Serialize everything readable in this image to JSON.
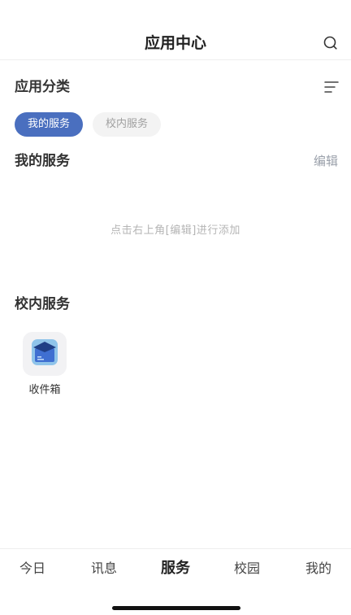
{
  "header": {
    "title": "应用中心"
  },
  "categories": {
    "label": "应用分类"
  },
  "chips": [
    {
      "label": "我的服务"
    },
    {
      "label": "校内服务"
    }
  ],
  "my_services": {
    "title": "我的服务",
    "edit_label": "编辑",
    "empty_hint": "点击右上角[编辑]进行添加"
  },
  "campus_services": {
    "title": "校内服务",
    "apps": [
      {
        "label": "收件箱",
        "icon": "inbox-icon"
      }
    ]
  },
  "tabbar": {
    "tabs": [
      {
        "label": "今日"
      },
      {
        "label": "讯息"
      },
      {
        "label": "服务"
      },
      {
        "label": "校园"
      },
      {
        "label": "我的"
      }
    ],
    "active_index": 2
  },
  "colors": {
    "accent": "#4a6fbf",
    "hint": "#b5b5b5",
    "chip_inactive_bg": "#f3f3f3"
  }
}
